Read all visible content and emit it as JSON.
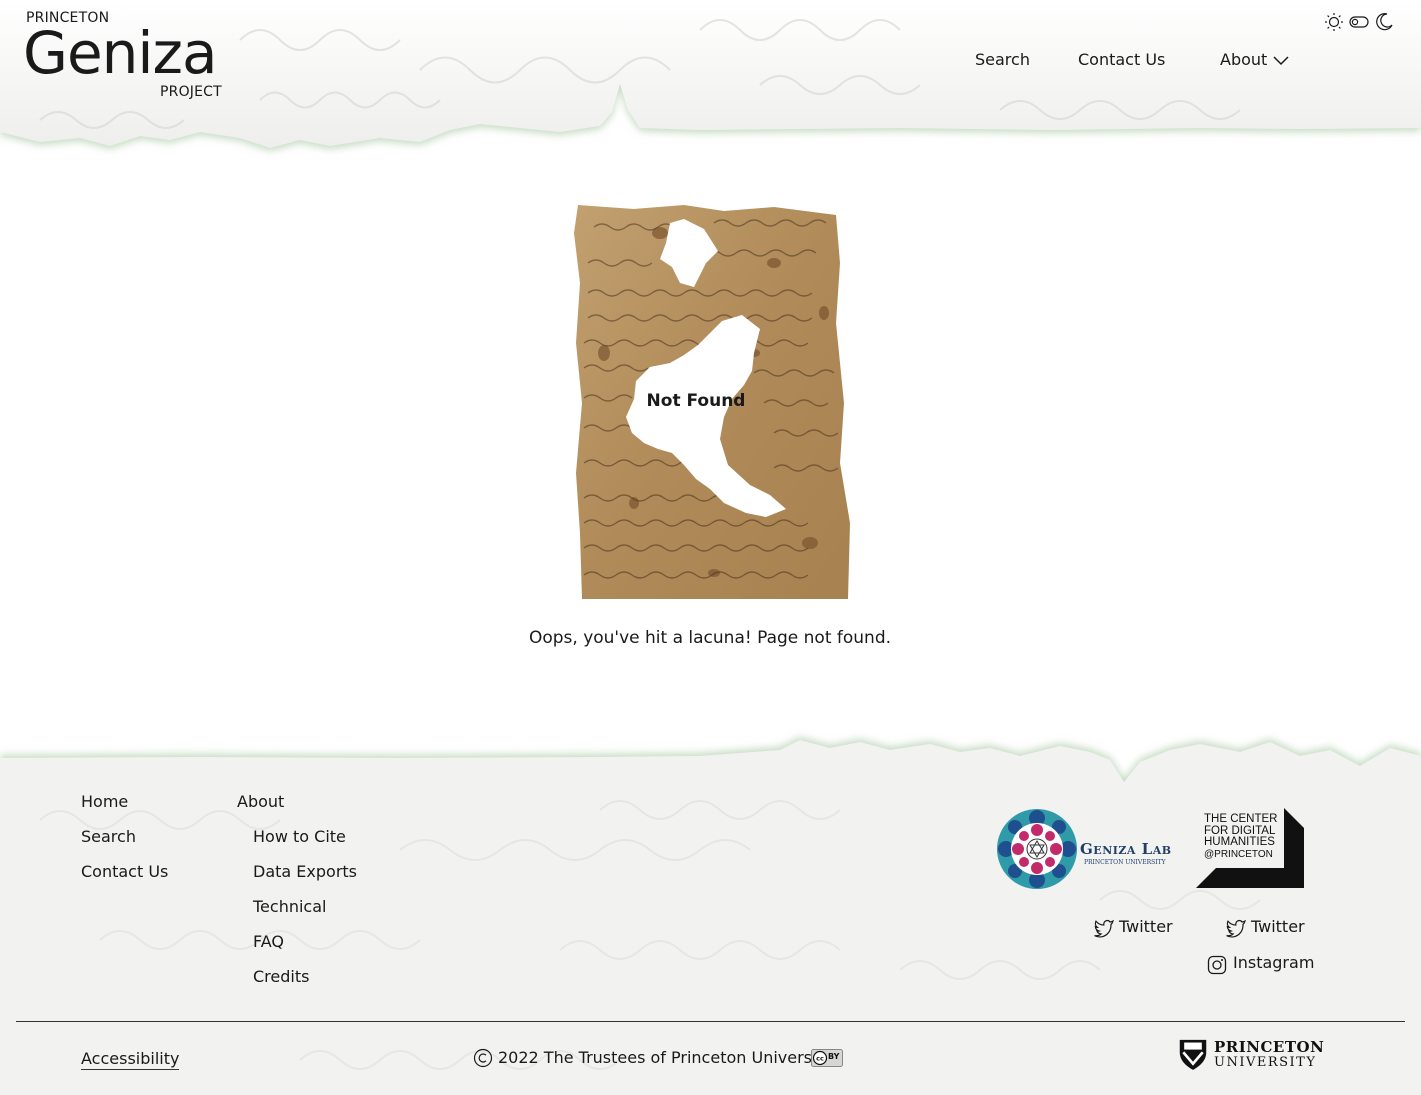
{
  "header": {
    "logo": {
      "top": "PRINCETON",
      "main": "Geniza",
      "bottom": "PROJECT"
    },
    "nav": {
      "search": "Search",
      "contact": "Contact Us",
      "about": "About"
    },
    "theme_icons": [
      "sun-icon",
      "toggle-icon",
      "moon-icon"
    ]
  },
  "main": {
    "not_found": "Not Found",
    "message": "Oops, you've hit a lacuna! Page not found."
  },
  "footer": {
    "col1": [
      "Home",
      "Search",
      "Contact Us"
    ],
    "col2_title": "About",
    "col2": [
      "How to Cite",
      "Data Exports",
      "Technical",
      "FAQ",
      "Credits"
    ],
    "geniza_lab": {
      "name": "Geniza Lab",
      "sub": "PRINCETON UNIVERSITY"
    },
    "cdh": [
      "THE CENTER",
      "FOR DIGITAL",
      "HUMANITIES",
      "@PRINCETON"
    ],
    "social": {
      "twitter1": "Twitter",
      "twitter2": "Twitter",
      "instagram": "Instagram"
    },
    "accessibility": "Accessibility",
    "copyright": "2022 The Trustees of Princeton University",
    "cc_label": "BY",
    "princeton_logo": [
      "PRINCETON",
      "UNIVERSITY"
    ]
  },
  "colors": {
    "text": "#1a1a1a",
    "paper": "#f2f2f1",
    "fragment": "#b8966a",
    "torn_edge": "#cfe0cc"
  }
}
